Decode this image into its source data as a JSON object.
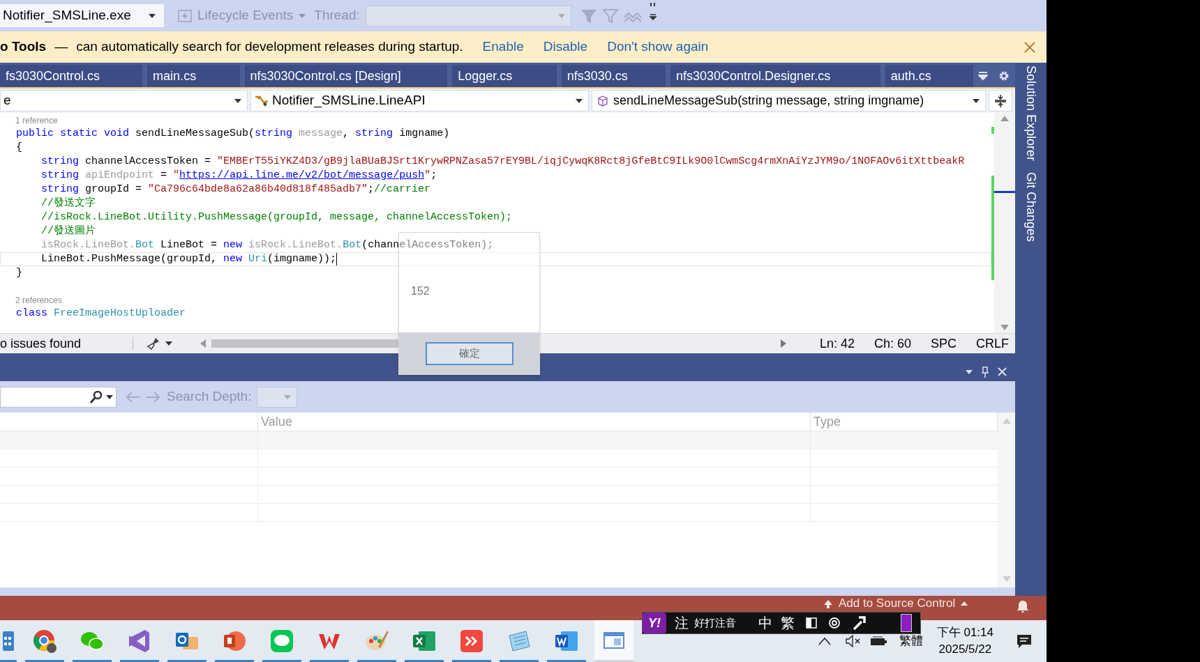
{
  "toolbar": {
    "process": "Notifier_SMSLine.exe",
    "lifecycle": "Lifecycle Events",
    "thread_label": "Thread:"
  },
  "infobar": {
    "title": "o Tools",
    "dash": "—",
    "message": "can automatically search for development releases during startup.",
    "links": [
      "Enable",
      "Disable",
      "Don't show again"
    ]
  },
  "tabs": [
    {
      "label": "fs3030Control.cs",
      "selected": false
    },
    {
      "label": "main.cs",
      "selected": false
    },
    {
      "label": "nfs3030Control.cs [Design]",
      "selected": false
    },
    {
      "label": "Logger.cs",
      "selected": false
    },
    {
      "label": "nfs3030.cs",
      "selected": false
    },
    {
      "label": "nfs3030Control.Designer.cs",
      "selected": false
    },
    {
      "label": "auth.cs",
      "selected": false
    }
  ],
  "nav": {
    "project": "e",
    "class": "Notifier_SMSLine.LineAPI",
    "member": "sendLineMessageSub(string message, string imgname)"
  },
  "code": {
    "lines": [
      {
        "kind": "lens",
        "text": "1 reference"
      },
      {
        "kind": "code",
        "current": false,
        "segments": [
          {
            "kind": "kw",
            "text": "public static void "
          },
          {
            "kind": "plain",
            "text": "sendLineMessageSub("
          },
          {
            "kind": "kw",
            "text": "string "
          },
          {
            "kind": "dim",
            "text": "message"
          },
          {
            "kind": "plain",
            "text": ", "
          },
          {
            "kind": "kw",
            "text": "string "
          },
          {
            "kind": "plain",
            "text": "imgname)"
          }
        ]
      },
      {
        "kind": "code",
        "current": false,
        "segments": [
          {
            "kind": "plain",
            "text": "{"
          }
        ],
        "children": [
          {
            "kind": "code",
            "current": false,
            "segments": [
              {
                "kind": "kw",
                "text": "string "
              },
              {
                "kind": "plain",
                "text": "channelAccessToken = "
              },
              {
                "kind": "str",
                "text": "\"EMBErT55iYKZ4D3/gB9jlaBUaBJSrt1KrywRPNZasa57rEY9BL/iqjCywqK8Rct8jGfeBtC9ILk9O0lCwmScg4rmXnAiYzJYM9o/1NOFAOv6itXttbeakR"
              }
            ]
          },
          {
            "kind": "code",
            "current": false,
            "segments": [
              {
                "kind": "kw",
                "text": "string "
              },
              {
                "kind": "dim",
                "text": "apiEndpoint"
              },
              {
                "kind": "plain",
                "text": " = "
              },
              {
                "kind": "str",
                "text": "\""
              },
              {
                "kind": "link",
                "text": "https://api.line.me/v2/bot/message/push"
              },
              {
                "kind": "str",
                "text": "\""
              },
              {
                "kind": "plain",
                "text": ";"
              }
            ]
          },
          {
            "kind": "code",
            "current": false,
            "segments": [
              {
                "kind": "kw",
                "text": "string "
              },
              {
                "kind": "plain",
                "text": "groupId = "
              },
              {
                "kind": "str",
                "text": "\"Ca796c64bde8a62a86b40d818f485adb7\""
              },
              {
                "kind": "plain",
                "text": ";"
              },
              {
                "kind": "cmt",
                "text": "//carrier"
              }
            ]
          },
          {
            "kind": "code",
            "current": false,
            "segments": [
              {
                "kind": "cmt",
                "text": "//發送文字"
              }
            ]
          },
          {
            "kind": "code",
            "current": false,
            "segments": [
              {
                "kind": "cmt",
                "text": "//isRock.LineBot.Utility.PushMessage(groupId, message, channelAccessToken);"
              }
            ]
          },
          {
            "kind": "code",
            "current": false,
            "segments": [
              {
                "kind": "cmt",
                "text": "//發送圖片"
              }
            ]
          },
          {
            "kind": "code",
            "current": false,
            "segments": [
              {
                "kind": "dim",
                "text": "isRock.LineBot."
              },
              {
                "kind": "type",
                "text": "Bot"
              },
              {
                "kind": "plain",
                "text": " LineBot = "
              },
              {
                "kind": "kw",
                "text": "new "
              },
              {
                "kind": "dim",
                "text": "isRock.LineBot."
              },
              {
                "kind": "type",
                "text": "Bot"
              },
              {
                "kind": "plain",
                "text": "(channelAccessToken);"
              }
            ]
          },
          {
            "kind": "code",
            "current": true,
            "segments": [
              {
                "kind": "plain",
                "text": "LineBot.PushMessage(groupId, "
              },
              {
                "kind": "kw",
                "text": "new "
              },
              {
                "kind": "type",
                "text": "Uri"
              },
              {
                "kind": "plain",
                "text": "(imgname));"
              }
            ]
          }
        ]
      },
      {
        "kind": "code",
        "current": false,
        "segments": [
          {
            "kind": "plain",
            "text": "}"
          }
        ]
      },
      {
        "kind": "blank"
      },
      {
        "kind": "lens",
        "text": "2 references"
      },
      {
        "kind": "code",
        "current": false,
        "segments": [
          {
            "kind": "kw",
            "text": "class "
          },
          {
            "kind": "type",
            "text": "FreeImageHostUploader"
          }
        ]
      }
    ]
  },
  "dialog": {
    "value": "152",
    "button": "確定"
  },
  "status": {
    "issues": "o issues found",
    "ln": "Ln: 42",
    "ch": "Ch: 60",
    "spaces": "SPC",
    "eol": "CRLF"
  },
  "side_tabs": [
    "Solution Explorer",
    "Git Changes"
  ],
  "panel": {
    "search_depth_label": "Search Depth:",
    "columns": [
      "Value",
      "Type"
    ]
  },
  "source_control": {
    "label": "Add to Source Control"
  },
  "ime": {
    "logo": "Y!",
    "items": [
      "注",
      "好打注音",
      "中",
      "繁"
    ]
  },
  "taskbar": {
    "apps": [
      {
        "kind": "grid",
        "active": false
      },
      {
        "kind": "ring",
        "active": false
      },
      {
        "kind": "chat",
        "active": false
      },
      {
        "kind": "ribbon",
        "active": false
      },
      {
        "kind": "mail",
        "active": false
      },
      {
        "kind": "slides",
        "active": false
      },
      {
        "kind": "bubble",
        "active": false
      },
      {
        "kind": "wmark",
        "active": false
      },
      {
        "kind": "palette",
        "active": false
      },
      {
        "kind": "sheet",
        "active": false
      },
      {
        "kind": "diamond",
        "active": false
      },
      {
        "kind": "notepad",
        "active": false
      },
      {
        "kind": "doc",
        "active": false
      },
      {
        "kind": "window",
        "active": true
      }
    ],
    "language": "繁體",
    "time": "下午 01:14",
    "date": "2025/5/22"
  }
}
